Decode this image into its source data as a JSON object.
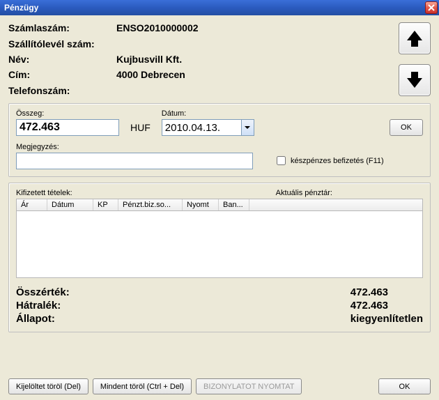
{
  "window": {
    "title": "Pénzügy"
  },
  "header": {
    "labels": {
      "invoice_no": "Számlaszám:",
      "delivery_no": "Szállítólevél szám:",
      "name": "Név:",
      "address": "Cím:",
      "phone": "Telefonszám:"
    },
    "values": {
      "invoice_no": "ENSO2010000002",
      "delivery_no": "",
      "name": "Kujbusvill Kft.",
      "address": "4000 Debrecen",
      "phone": ""
    }
  },
  "form": {
    "amount_label": "Összeg:",
    "amount_value": "472.463",
    "currency": "HUF",
    "date_label": "Dátum:",
    "date_value": "2010.04.13.",
    "ok_label": "OK",
    "note_label": "Megjegyzés:",
    "note_value": "",
    "cash_checkbox_label": "készpénzes befizetés (F11)",
    "cash_checked": false
  },
  "items": {
    "paid_label": "Kifizetett tételek:",
    "cashreg_label": "Aktuális pénztár:",
    "columns": [
      "Ár",
      "Dátum",
      "KP",
      "Pénzt.biz.so...",
      "Nyomt",
      "Ban..."
    ],
    "rows": []
  },
  "totals": {
    "total_label": "Összérték:",
    "total_value": "472.463",
    "balance_label": "Hátralék:",
    "balance_value": "472.463",
    "status_label": "Állapot:",
    "status_value": "kiegyenlítetlen"
  },
  "buttons": {
    "delete_selected": "Kijelöltet töröl (Del)",
    "delete_all": "Mindent töröl (Ctrl + Del)",
    "print_receipt": "BIZONYLATOT NYOMTAT",
    "ok": "OK"
  }
}
